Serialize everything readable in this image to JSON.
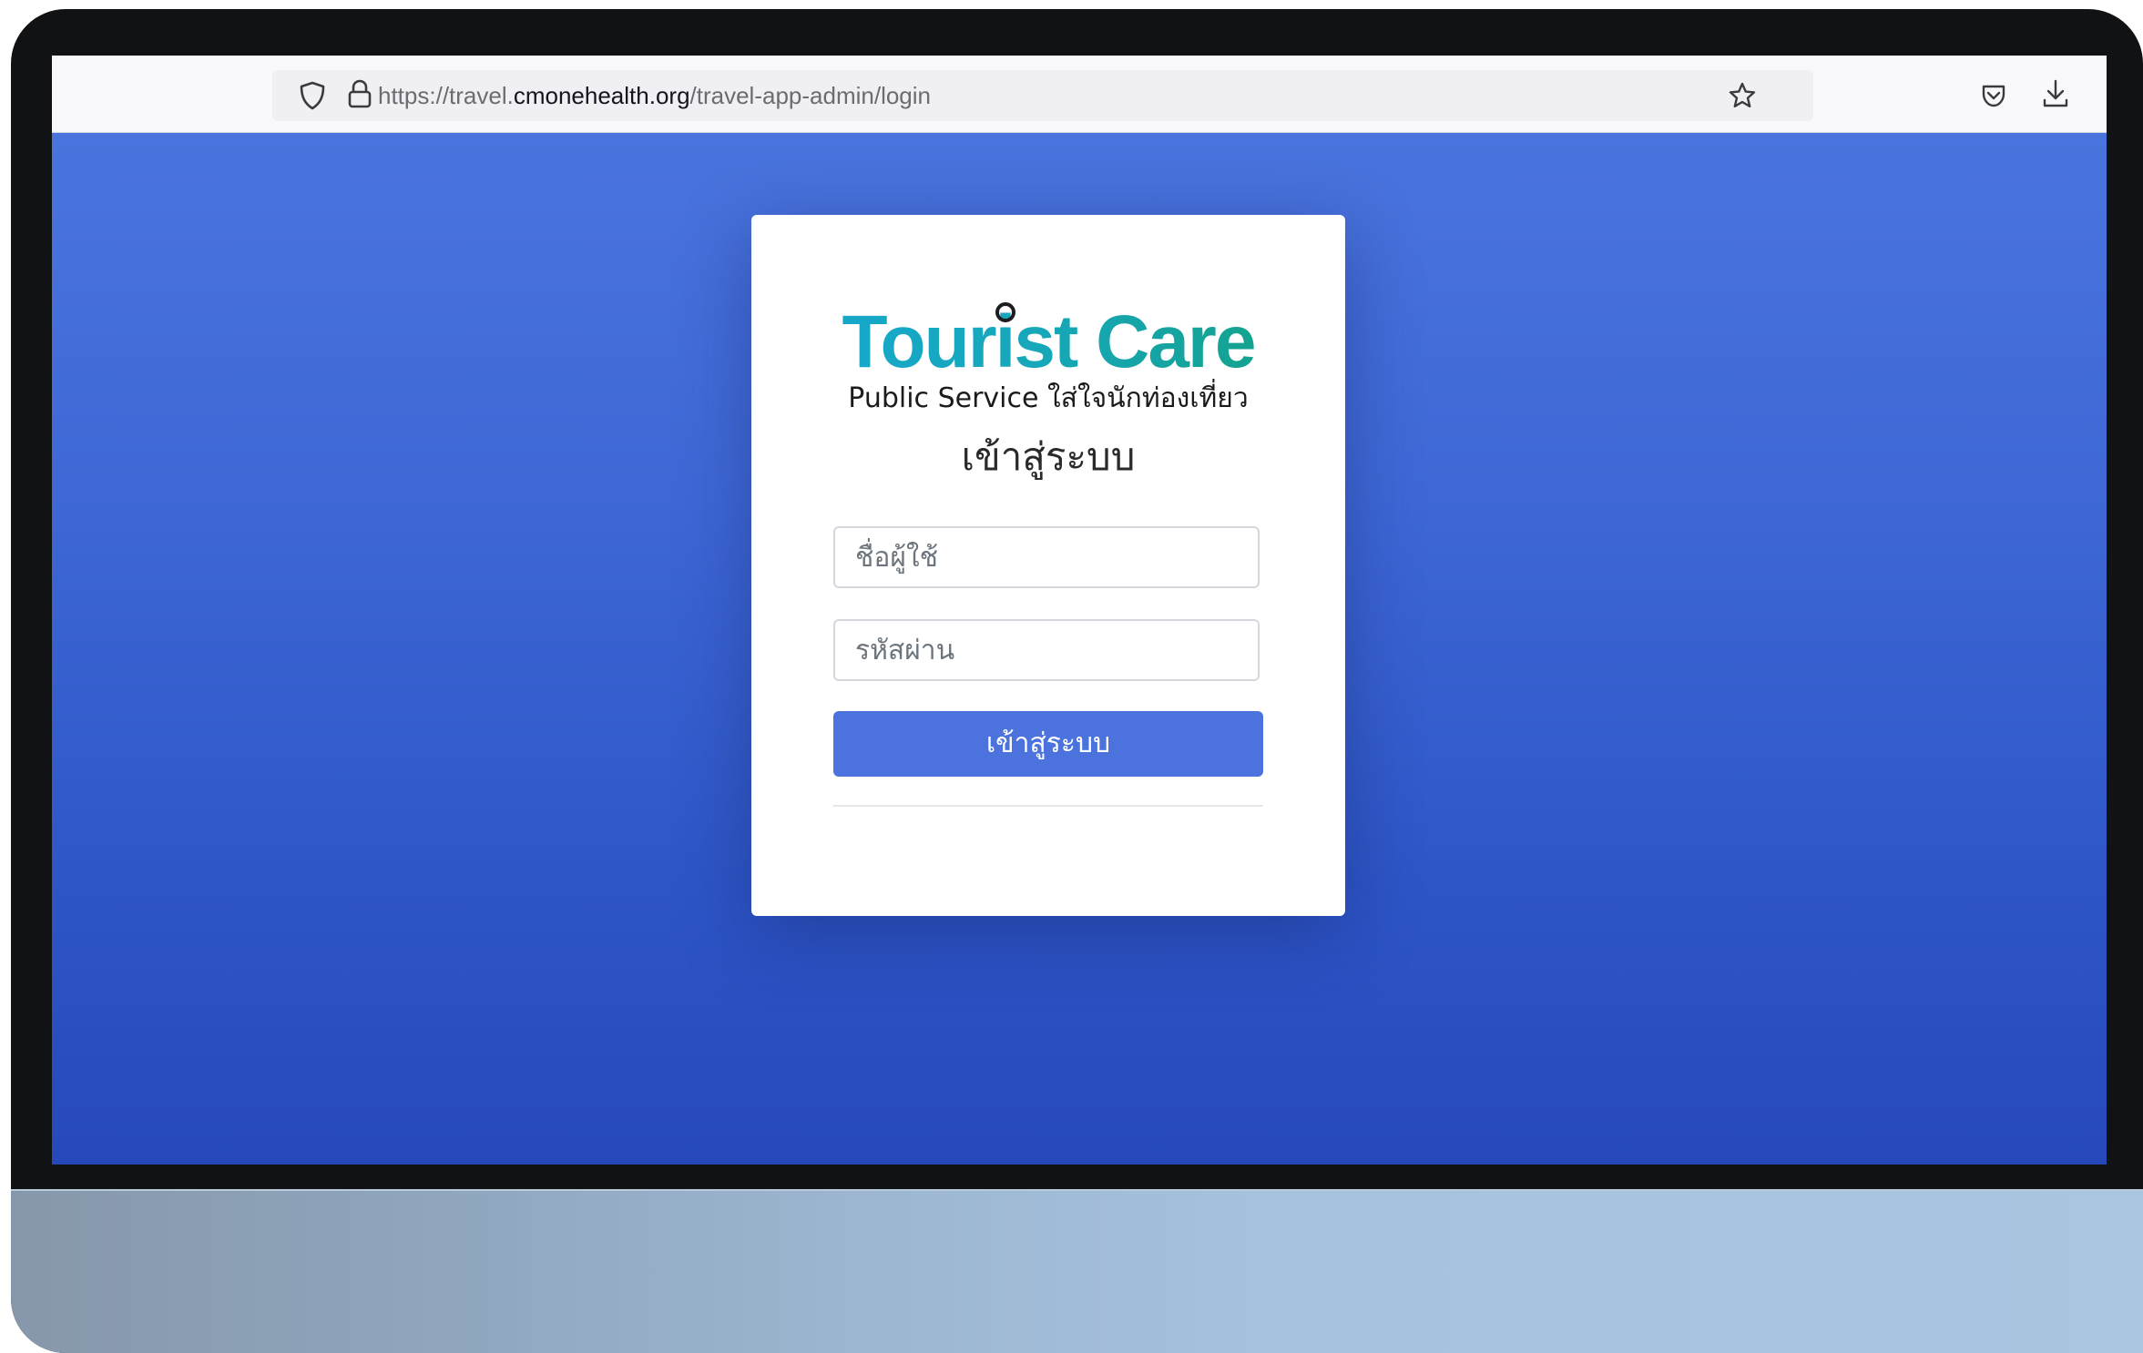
{
  "browser": {
    "url_scheme_prefix": "https://travel.",
    "url_host": "cmonehealth.org",
    "url_path": "/travel-app-admin/login",
    "icons": {
      "tracking": "shield-icon",
      "security": "lock-icon",
      "bookmark": "star-icon",
      "pocket": "pocket-icon",
      "downloads": "download-icon"
    }
  },
  "login_card": {
    "logo_text": "Tourist Care",
    "logo_tagline": "Public Service ใส่ใจนักท่องเที่ยว",
    "title": "เข้าสู่ระบบ",
    "username_placeholder": "ชื่อผู้ใช้",
    "password_placeholder": "รหัสผ่าน",
    "submit_label": "เข้าสู่ระบบ"
  },
  "colors": {
    "primary_button": "#4b72dd",
    "background_top": "#4a74dd",
    "background_bottom": "#2648bb",
    "logo_blue": "#17a9d1",
    "logo_green": "#13a07e"
  }
}
